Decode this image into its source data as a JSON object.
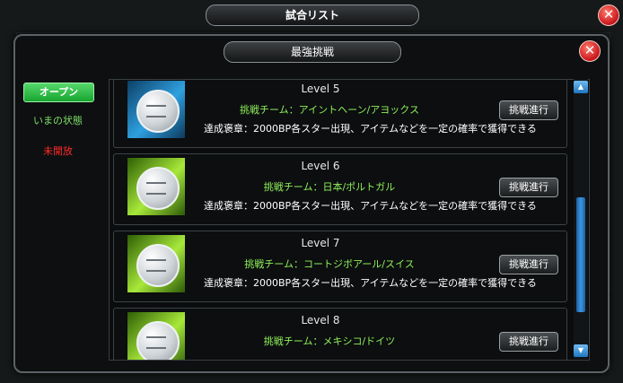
{
  "window": {
    "title": "試合リスト",
    "close_glyph": "✕"
  },
  "modal": {
    "title": "最強挑戦",
    "close_glyph": "✕"
  },
  "filters": [
    {
      "label": "オープン",
      "color": "#ffffff"
    },
    {
      "label": "いまの状態",
      "color": "#7ee06a"
    },
    {
      "label": "未開放",
      "color": "#ff2a2a"
    }
  ],
  "levels": [
    {
      "level": "Level 5",
      "team": "挑戦チーム：アイントヘーン/アヨックス",
      "reward": "達成褒章：2000BP各スター出現、アイテムなどを一定の確率で獲得できる",
      "button": "挑戦進行",
      "medal_bg": "blue"
    },
    {
      "level": "Level 6",
      "team": "挑戦チーム：日本/ポルトガル",
      "reward": "達成褒章：2000BP各スター出現、アイテムなどを一定の確率で獲得できる",
      "button": "挑戦進行",
      "medal_bg": "green"
    },
    {
      "level": "Level 7",
      "team": "挑戦チーム：コートジボアール/スイス",
      "reward": "達成褒章：2000BP各スター出現、アイテムなどを一定の確率で獲得できる",
      "button": "挑戦進行",
      "medal_bg": "green"
    },
    {
      "level": "Level 8",
      "team": "挑戦チーム：メキシコ/ドイツ",
      "reward": "",
      "button": "挑戦進行",
      "medal_bg": "green"
    }
  ],
  "scroll": {
    "up_glyph": "▲",
    "down_glyph": "▼"
  }
}
